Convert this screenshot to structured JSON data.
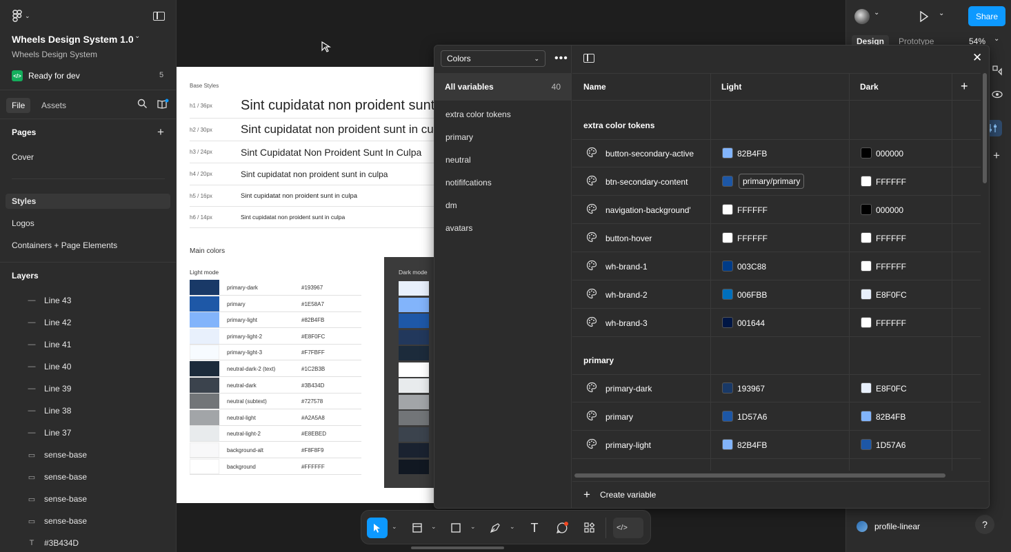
{
  "file": {
    "title": "Wheels Design System 1.0",
    "team": "Wheels Design System",
    "status_label": "Ready for dev",
    "status_count": "5"
  },
  "left_tabs": {
    "file": "File",
    "assets": "Assets"
  },
  "pages": {
    "header": "Pages",
    "items": [
      "Cover",
      "Styles",
      "Logos",
      "Containers + Page Elements"
    ],
    "selected": "Styles"
  },
  "layers": {
    "header": "Layers",
    "items": [
      {
        "type": "line",
        "name": "Line 43"
      },
      {
        "type": "line",
        "name": "Line 42"
      },
      {
        "type": "line",
        "name": "Line 41"
      },
      {
        "type": "line",
        "name": "Line 40"
      },
      {
        "type": "line",
        "name": "Line 39"
      },
      {
        "type": "line",
        "name": "Line 38"
      },
      {
        "type": "line",
        "name": "Line 37"
      },
      {
        "type": "frame",
        "name": "sense-base"
      },
      {
        "type": "frame",
        "name": "sense-base"
      },
      {
        "type": "frame",
        "name": "sense-base"
      },
      {
        "type": "frame",
        "name": "sense-base"
      },
      {
        "type": "text",
        "name": "#3B434D"
      }
    ]
  },
  "canvas": {
    "base_styles_label": "Base Styles",
    "headings": [
      {
        "tag": "h1 / 36px",
        "sample": "Sint cupidatat non proident sunt in culpa"
      },
      {
        "tag": "h2 / 30px",
        "sample": "Sint cupidatat non proident sunt in culpa"
      },
      {
        "tag": "h3 / 24px",
        "sample": "Sint Cupidatat Non Proident Sunt In Culpa"
      },
      {
        "tag": "h4 / 20px",
        "sample": "Sint cupidatat non proident sunt in culpa"
      },
      {
        "tag": "h5 / 16px",
        "sample": "Sint cupidatat non proident sunt in culpa"
      },
      {
        "tag": "h6 / 14px",
        "sample": "Sint cupidatat non proident sunt in culpa"
      }
    ],
    "main_colors_label": "Main colors",
    "light_mode_label": "Light mode",
    "dark_mode_label": "Dark mode",
    "light_colors": [
      {
        "name": "primary-dark",
        "hex": "#193967",
        "color": "#193967"
      },
      {
        "name": "primary",
        "hex": "#1E58A7",
        "color": "#1E58A7"
      },
      {
        "name": "primary-light",
        "hex": "#82B4FB",
        "color": "#82B4FB"
      },
      {
        "name": "primary-light-2",
        "hex": "#E8F0FC",
        "color": "#E8F0FC"
      },
      {
        "name": "primary-light-3",
        "hex": "#F7FBFF",
        "color": "#F7FBFF"
      },
      {
        "name": "neutral-dark-2 (text)",
        "hex": "#1C2B3B",
        "color": "#1C2B3B"
      },
      {
        "name": "neutral-dark",
        "hex": "#3B434D",
        "color": "#3B434D"
      },
      {
        "name": "neutral (subtext)",
        "hex": "#727578",
        "color": "#727578"
      },
      {
        "name": "neutral-light",
        "hex": "#A2A5A8",
        "color": "#A2A5A8"
      },
      {
        "name": "neutral-light-2",
        "hex": "#E8EBED",
        "color": "#E8EBED"
      },
      {
        "name": "background-alt",
        "hex": "#F8F8F9",
        "color": "#F8F8F9"
      },
      {
        "name": "background",
        "hex": "#FFFFFF",
        "color": "#FFFFFF"
      }
    ],
    "dark_colors": [
      "#E8F0FC",
      "#82B4FB",
      "#1E58A7",
      "#22385C",
      "#1C2B3B",
      "#FFFFFF",
      "#E8EBED",
      "#A2A5A8",
      "#727578",
      "#3B434D",
      "#1A2230",
      "#111822"
    ]
  },
  "right_panel": {
    "tabs": {
      "design": "Design",
      "prototype": "Prototype"
    },
    "zoom": "54%",
    "share_label": "Share",
    "bottom_item": "profile-linear",
    "help": "?"
  },
  "variables": {
    "collection": "Colors",
    "all_label": "All variables",
    "all_count": "40",
    "groups": [
      "extra color tokens",
      "primary",
      "neutral",
      "notififcations",
      "dm",
      "avatars"
    ],
    "columns": {
      "name": "Name",
      "light": "Light",
      "dark": "Dark"
    },
    "sections": [
      {
        "title": "extra color tokens",
        "rows": [
          {
            "name": "button-secondary-active",
            "light": "82B4FB",
            "light_color": "#82B4FB",
            "dark": "000000",
            "dark_color": "#000000"
          },
          {
            "name": "btn-secondary-content",
            "light": "primary/primary",
            "light_color": "#1D57A6",
            "light_alias": true,
            "dark": "FFFFFF",
            "dark_color": "#FFFFFF"
          },
          {
            "name": "navigation-background'",
            "light": "FFFFFF",
            "light_color": "#FFFFFF",
            "dark": "000000",
            "dark_color": "#000000"
          },
          {
            "name": "button-hover",
            "light": "FFFFFF",
            "light_color": "#FFFFFF",
            "dark": "FFFFFF",
            "dark_color": "#FFFFFF"
          },
          {
            "name": "wh-brand-1",
            "light": "003C88",
            "light_color": "#003C88",
            "dark": "FFFFFF",
            "dark_color": "#FFFFFF"
          },
          {
            "name": "wh-brand-2",
            "light": "006FBB",
            "light_color": "#006FBB",
            "dark": "E8F0FC",
            "dark_color": "#E8F0FC"
          },
          {
            "name": "wh-brand-3",
            "light": "001644",
            "light_color": "#001644",
            "dark": "FFFFFF",
            "dark_color": "#FFFFFF"
          }
        ]
      },
      {
        "title": "primary",
        "rows": [
          {
            "name": "primary-dark",
            "light": "193967",
            "light_color": "#193967",
            "dark": "E8F0FC",
            "dark_color": "#E8F0FC"
          },
          {
            "name": "primary",
            "light": "1D57A6",
            "light_color": "#1D57A6",
            "dark": "82B4FB",
            "dark_color": "#82B4FB"
          },
          {
            "name": "primary-light",
            "light": "82B4FB",
            "light_color": "#82B4FB",
            "dark": "1D57A6",
            "dark_color": "#1D57A6"
          }
        ]
      }
    ],
    "create_label": "Create variable"
  }
}
